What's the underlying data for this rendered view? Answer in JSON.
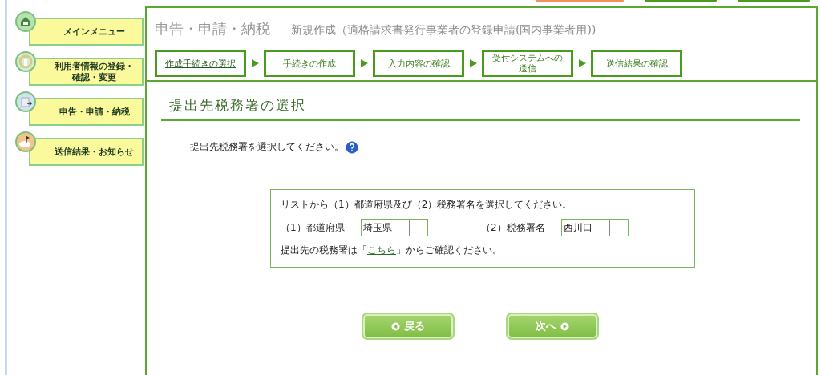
{
  "top_tabs": [
    {
      "color": "#f0905a"
    },
    {
      "color": "#4a9a1e"
    },
    {
      "color": "#4a9a1e"
    }
  ],
  "sidebar": {
    "items": [
      {
        "lines": [
          "メインメニュー"
        ]
      },
      {
        "lines": [
          "利用者情報の登録・",
          "確認・変更"
        ]
      },
      {
        "lines": [
          "申告・申請・納税"
        ]
      },
      {
        "lines": [
          "送信結果・お知らせ"
        ]
      }
    ]
  },
  "header": {
    "title": "申告・申請・納税",
    "subtitle": "新規作成（適格請求書発行事業者の登録申請(国内事業者用))"
  },
  "steps": [
    {
      "label": "作成手続きの選択",
      "selected": true
    },
    {
      "label": "手続きの作成",
      "selected": false
    },
    {
      "label": "入力内容の確認",
      "selected": false
    },
    {
      "lines": [
        "受付システムへの",
        "送信"
      ],
      "selected": false
    },
    {
      "label": "送信結果の確認",
      "selected": false
    }
  ],
  "section": {
    "heading": "提出先税務署の選択",
    "instruction": "提出先税務署を選択してください。"
  },
  "form": {
    "prompt": "リストから（1）都道府県及び（2）税務署名を選択してください。",
    "selects": [
      {
        "label": "（1）都道府県",
        "value": "埼玉県"
      },
      {
        "label": "（2）税務署名",
        "value": "西川口"
      }
    ],
    "note_before": "提出先の税務署は「",
    "link": "こちら",
    "note_after": "」からご確認ください。"
  },
  "buttons": [
    {
      "label": "戻る",
      "kind": "back"
    },
    {
      "label": "次へ",
      "kind": "next"
    }
  ]
}
